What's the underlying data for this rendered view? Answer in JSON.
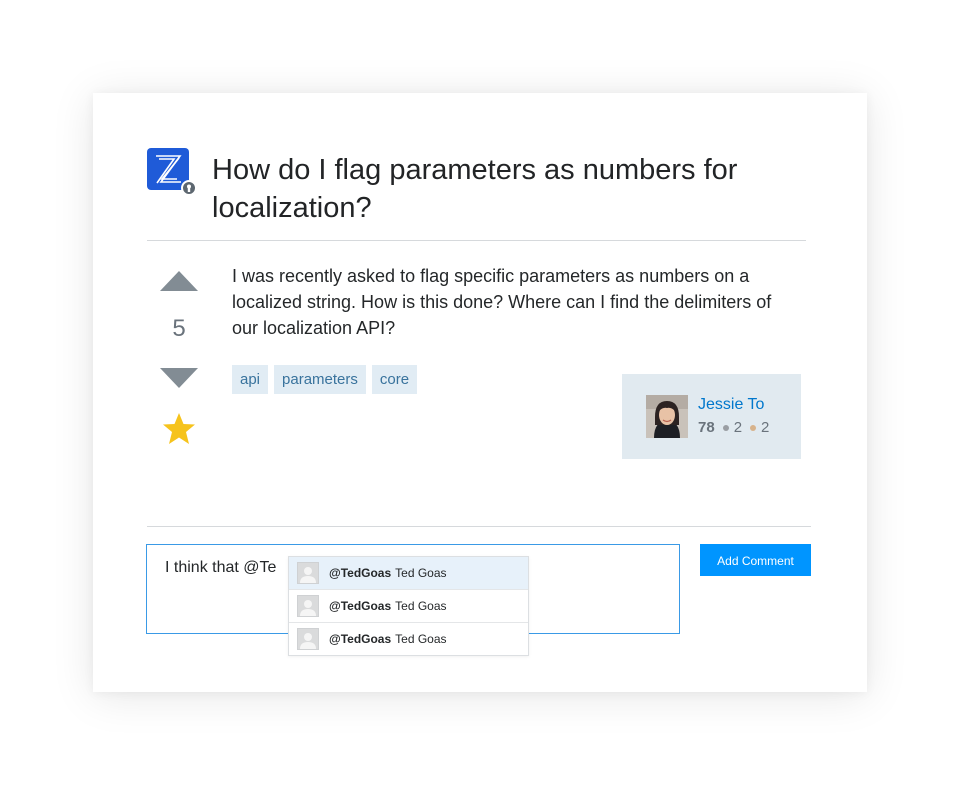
{
  "question": {
    "title": "How do I flag parameters as numbers for localization?",
    "body": "I was recently asked to flag specific parameters as numbers on a localized string. How is this done? Where can I find the delimiters of our localization API?",
    "votes": "5",
    "tags": [
      "api",
      "parameters",
      "core"
    ]
  },
  "author": {
    "name": "Jessie To",
    "reputation": "78",
    "silver_badges": "2",
    "bronze_badges": "2"
  },
  "comment": {
    "value": "I think that @Te",
    "button_label": "Add Comment",
    "suggestions": [
      {
        "handle": "@TedGoas",
        "name": "Ted Goas"
      },
      {
        "handle": "@TedGoas",
        "name": "Ted Goas"
      },
      {
        "handle": "@TedGoas",
        "name": "Ted Goas"
      }
    ]
  },
  "colors": {
    "brand_blue": "#1f5bd8",
    "link": "#0077cc",
    "tag_bg": "#e1ecf4",
    "tag_text": "#39739d",
    "button": "#0095ff",
    "star": "#f6c31c"
  }
}
